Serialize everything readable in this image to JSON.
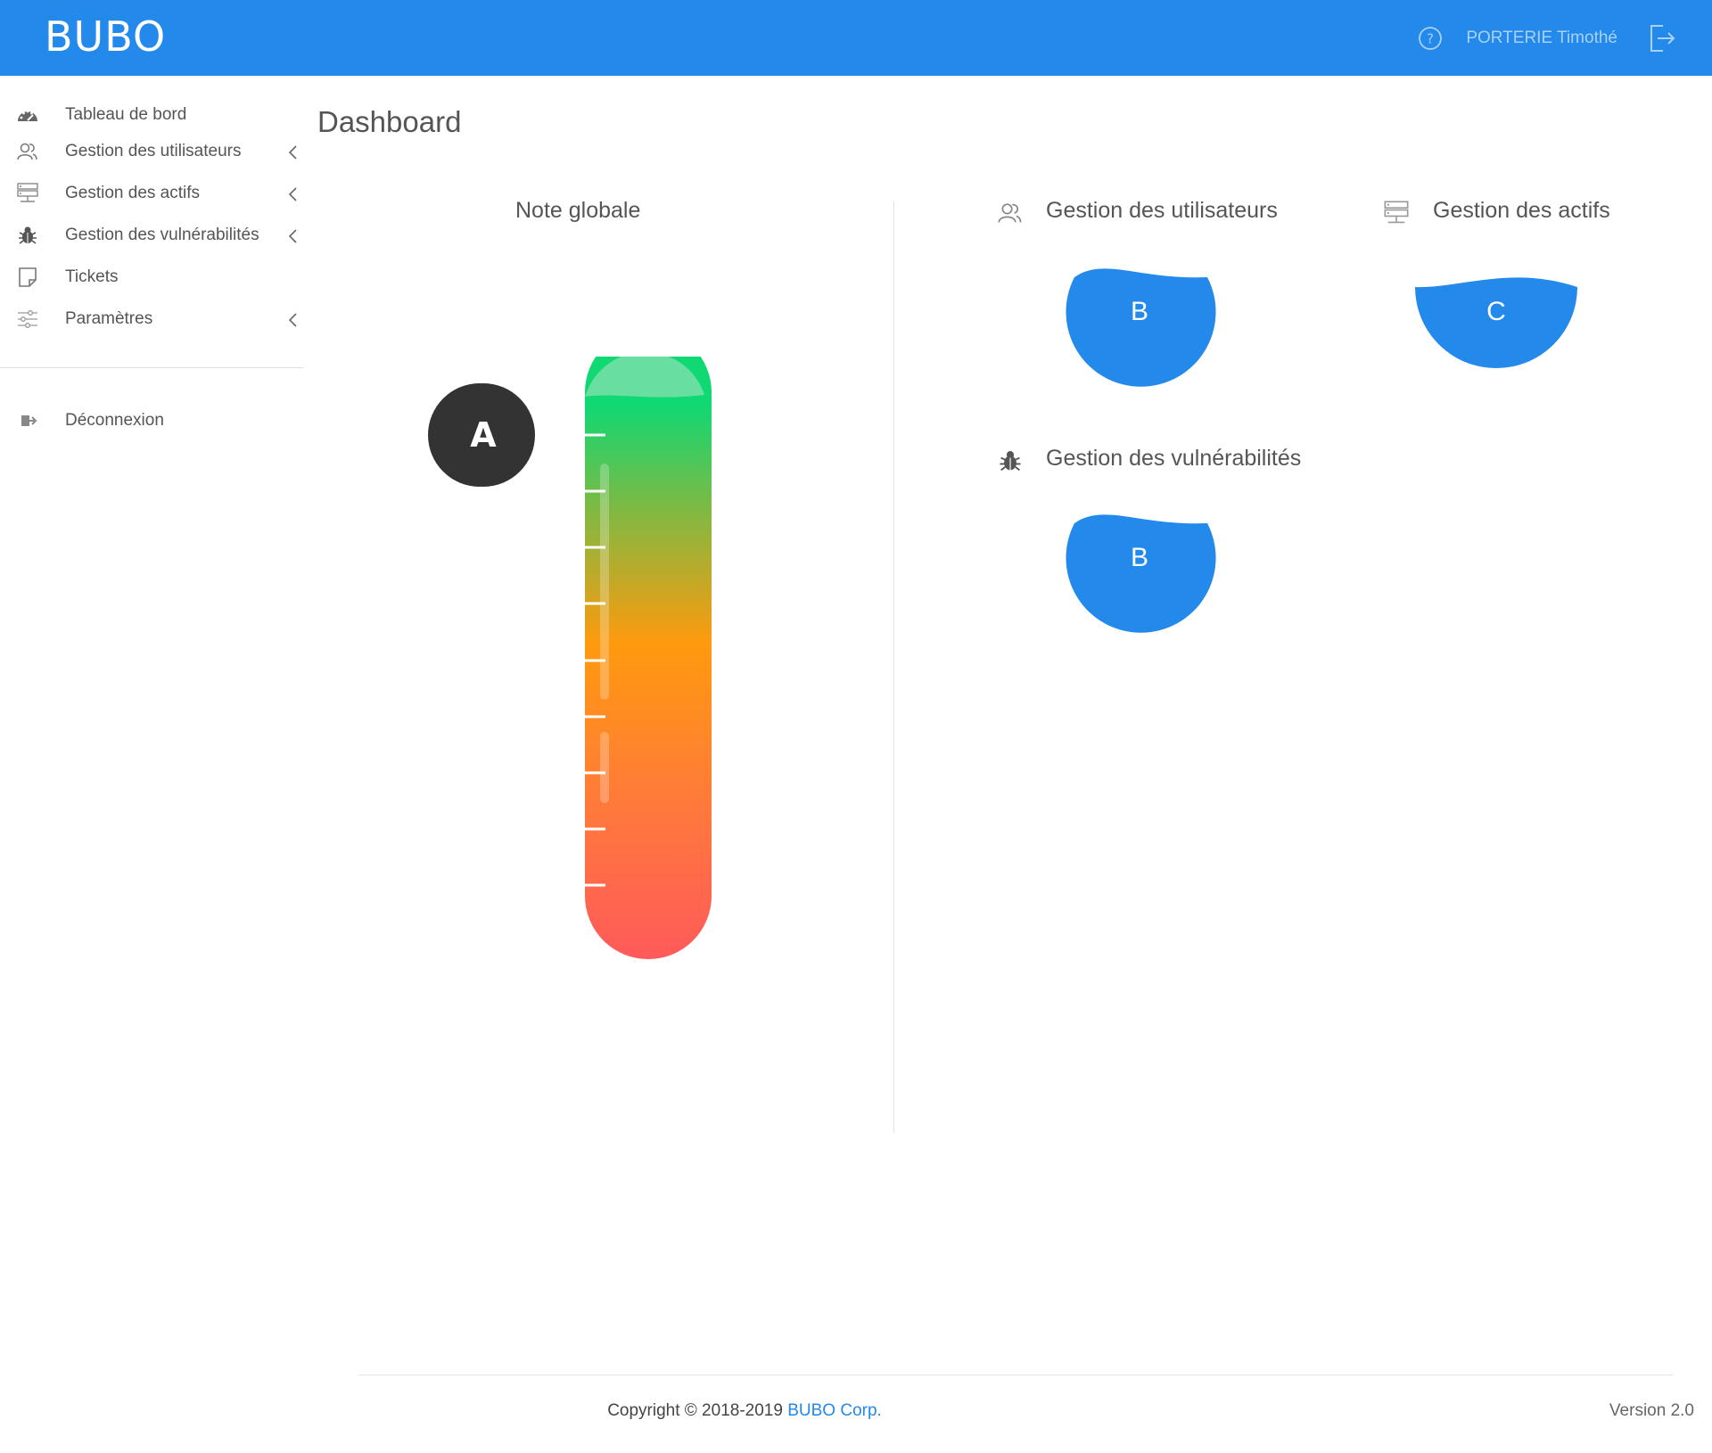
{
  "header": {
    "brand": "BUBO",
    "user_name": "PORTERIE Timothé",
    "icons": [
      "help-icon",
      "logout-icon"
    ]
  },
  "sidebar": {
    "items": [
      {
        "label": "Tableau de bord",
        "icon": "dashboard-icon",
        "has_submenu": false
      },
      {
        "label": "Gestion des utilisateurs",
        "icon": "users-icon",
        "has_submenu": true
      },
      {
        "label": "Gestion des actifs",
        "icon": "servers-icon",
        "has_submenu": true
      },
      {
        "label": "Gestion des vulnérabilités",
        "icon": "bug-icon",
        "has_submenu": true
      },
      {
        "label": "Tickets",
        "icon": "ticket-icon",
        "has_submenu": false
      },
      {
        "label": "Paramètres",
        "icon": "sliders-icon",
        "has_submenu": true
      }
    ],
    "logout_label": "Déconnexion"
  },
  "main": {
    "page_title": "Dashboard",
    "overall": {
      "title": "Note globale",
      "grade": "A"
    },
    "cards": [
      {
        "title": "Gestion des utilisateurs",
        "icon": "users-icon",
        "grade": "B"
      },
      {
        "title": "Gestion des actifs",
        "icon": "servers-icon",
        "grade": "C"
      },
      {
        "title": "Gestion des vulnérabilités",
        "icon": "bug-icon",
        "grade": "B"
      }
    ]
  },
  "footer": {
    "copyright": "Copyright © 2018-2019",
    "company": "BUBO Corp.",
    "version": "Version 2.0"
  },
  "colors": {
    "primary": "#2389ea",
    "header_user_text": "#a9d1fa",
    "grade_badge": "#2389ea",
    "pointer": "#333333",
    "gauge_top": "#10d873",
    "gauge_mid": "#ff9a0e",
    "gauge_bottom": "#ff5a5a"
  }
}
